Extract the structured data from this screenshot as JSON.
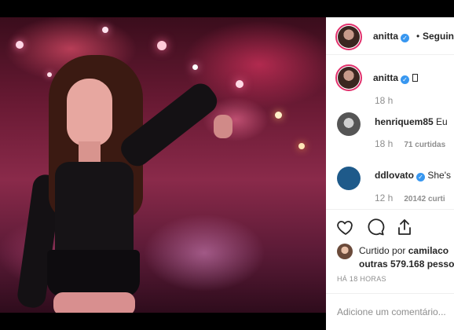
{
  "post_author": {
    "username": "anitta",
    "separator": "•",
    "follow_label": "Seguin"
  },
  "caption": {
    "username": "anitta",
    "time": "18 h"
  },
  "comments": [
    {
      "username": "henriquem85",
      "text": "Eu",
      "time": "18 h",
      "likes": "71 curtidas"
    },
    {
      "username": "ddlovato",
      "text": "She's",
      "time": "12 h",
      "likes": "20142 curti"
    }
  ],
  "likes": {
    "prefix": "Curtido por",
    "user": "camilaco",
    "others": "outras 579.168 pesso"
  },
  "time_ago": "HÁ 18 HORAS",
  "comment_placeholder": "Adicione um comentário...",
  "colors": {
    "verified": "#3897f0",
    "story_ring": "#e1306c",
    "text": "#262626",
    "muted": "#8e8e8e"
  }
}
